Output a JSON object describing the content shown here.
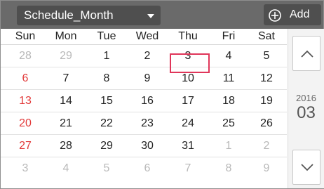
{
  "header": {
    "view_select": "Schedule_Month",
    "add_label": "Add"
  },
  "calendar": {
    "weekdays": [
      "Sun",
      "Mon",
      "Tue",
      "Wed",
      "Thu",
      "Fri",
      "Sat"
    ],
    "weeks": [
      [
        "28",
        "29",
        "1",
        "2",
        "3",
        "4",
        "5"
      ],
      [
        "6",
        "7",
        "8",
        "9",
        "10",
        "11",
        "12"
      ],
      [
        "13",
        "14",
        "15",
        "16",
        "17",
        "18",
        "19"
      ],
      [
        "20",
        "21",
        "22",
        "23",
        "24",
        "25",
        "26"
      ],
      [
        "27",
        "28",
        "29",
        "30",
        "31",
        "1",
        "2"
      ],
      [
        "3",
        "4",
        "5",
        "6",
        "7",
        "8",
        "9"
      ]
    ],
    "selected_day": "3",
    "year": "2016",
    "month": "03"
  },
  "icons": {
    "dropdown_caret": "caret-down-icon",
    "add": "plus-circle-icon",
    "prev": "chevron-up-icon",
    "next": "chevron-down-icon"
  },
  "colors": {
    "toolbar": "#6a6a6a",
    "sunday": "#e23a3a",
    "selected_border": "#e0365a",
    "outside_month": "#b8b8b8"
  }
}
